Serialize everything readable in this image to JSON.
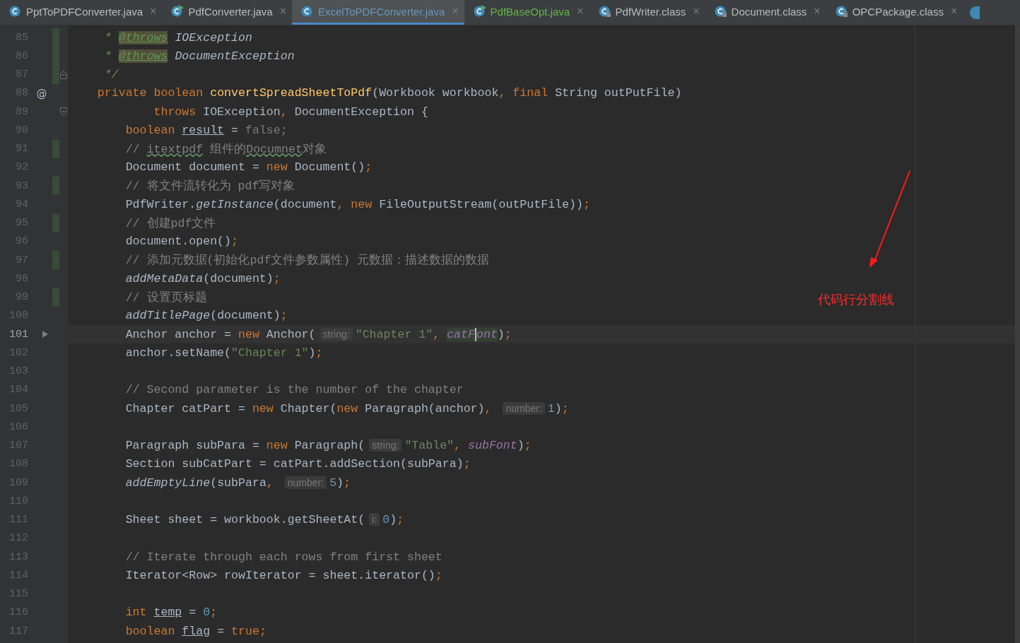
{
  "tabs": [
    {
      "label": "PptToPDFConverter.java",
      "kind": "class",
      "selected": false,
      "color": "#bbbbbb",
      "close": "×"
    },
    {
      "label": "PdfConverter.java",
      "kind": "runnable",
      "selected": false,
      "color": "#bbbbbb",
      "close": "×"
    },
    {
      "label": "ExcelToPDFConverter.java",
      "kind": "class",
      "selected": true,
      "color": "#6897bb",
      "close": "×"
    },
    {
      "label": "PdfBaseOpt.java",
      "kind": "runnable",
      "selected": false,
      "color": "#62b543",
      "close": "×"
    },
    {
      "label": "PdfWriter.class",
      "kind": "locked",
      "selected": false,
      "color": "#bbbbbb",
      "close": "×"
    },
    {
      "label": "Document.class",
      "kind": "locked",
      "selected": false,
      "color": "#bbbbbb",
      "close": "×"
    },
    {
      "label": "OPCPackage.class",
      "kind": "locked",
      "selected": false,
      "color": "#bbbbbb",
      "close": "×"
    }
  ],
  "lines": [
    {
      "number": "85",
      "changed": true,
      "current": false,
      "tokens": [
        {
          "kind": "doc",
          "text": "     * "
        },
        {
          "kind": "doctag",
          "text": "@throws"
        },
        {
          "kind": "docref",
          "text": " IOException"
        }
      ]
    },
    {
      "number": "86",
      "changed": true,
      "current": false,
      "tokens": [
        {
          "kind": "doc",
          "text": "     * "
        },
        {
          "kind": "doctag",
          "text": "@throws"
        },
        {
          "kind": "docref",
          "text": " DocumentException"
        }
      ]
    },
    {
      "number": "87",
      "changed": true,
      "current": false,
      "fold": {
        "kind": "end"
      },
      "tokens": [
        {
          "kind": "doc",
          "text": "     */"
        }
      ]
    },
    {
      "number": "88",
      "changed": false,
      "current": false,
      "gutter_mark": "@",
      "tokens": [
        {
          "kind": "keyword",
          "text": "    private boolean "
        },
        {
          "kind": "method",
          "text": "convertSpreadSheetToPdf"
        },
        {
          "kind": "plain",
          "text": "(Workbook workbook"
        },
        {
          "kind": "keyword",
          "text": ", final "
        },
        {
          "kind": "plain",
          "text": "String outPutFile)"
        }
      ]
    },
    {
      "number": "89",
      "changed": false,
      "current": false,
      "fold": {
        "kind": "start"
      },
      "tokens": [
        {
          "kind": "keyword",
          "text": "            throws"
        },
        {
          "kind": "plain",
          "text": " IOException"
        },
        {
          "kind": "keyword",
          "text": ","
        },
        {
          "kind": "plain",
          "text": " DocumentException {"
        }
      ]
    },
    {
      "number": "90",
      "changed": false,
      "current": false,
      "tokens": [
        {
          "kind": "keyword",
          "text": "        boolean "
        },
        {
          "kind": "underline",
          "text": "result"
        },
        {
          "kind": "plain",
          "text": " = "
        },
        {
          "kind": "dim",
          "text": "false;"
        }
      ]
    },
    {
      "number": "91",
      "changed": true,
      "current": false,
      "tokens": [
        {
          "kind": "comment",
          "text": "        // "
        },
        {
          "kind": "typo",
          "text": "itextpdf"
        },
        {
          "kind": "comment",
          "text": " 组件的"
        },
        {
          "kind": "typo",
          "text": "Documnet"
        },
        {
          "kind": "comment",
          "text": "对象"
        }
      ]
    },
    {
      "number": "92",
      "changed": false,
      "current": false,
      "tokens": [
        {
          "kind": "plain",
          "text": "        Document document = "
        },
        {
          "kind": "keyword",
          "text": "new"
        },
        {
          "kind": "plain",
          "text": " Document()"
        },
        {
          "kind": "keyword",
          "text": ";"
        }
      ]
    },
    {
      "number": "93",
      "changed": true,
      "current": false,
      "tokens": [
        {
          "kind": "comment",
          "text": "        // 将文件流转化为 pdf写对象"
        }
      ]
    },
    {
      "number": "94",
      "changed": false,
      "current": false,
      "tokens": [
        {
          "kind": "plain",
          "text": "        PdfWriter."
        },
        {
          "kind": "static",
          "text": "getInstance"
        },
        {
          "kind": "plain",
          "text": "(document"
        },
        {
          "kind": "keyword",
          "text": ", new"
        },
        {
          "kind": "plain",
          "text": " FileOutputStream(outPutFile))"
        },
        {
          "kind": "keyword",
          "text": ";"
        }
      ]
    },
    {
      "number": "95",
      "changed": true,
      "current": false,
      "tokens": [
        {
          "kind": "comment",
          "text": "        // 创建pdf文件"
        }
      ]
    },
    {
      "number": "96",
      "changed": false,
      "current": false,
      "tokens": [
        {
          "kind": "plain",
          "text": "        document.open()"
        },
        {
          "kind": "keyword",
          "text": ";"
        }
      ]
    },
    {
      "number": "97",
      "changed": true,
      "current": false,
      "tokens": [
        {
          "kind": "comment",
          "text": "        // 添加元数据(初始化pdf文件参数属性) 元数据：描述数据的数据"
        }
      ]
    },
    {
      "number": "98",
      "changed": false,
      "current": false,
      "tokens": [
        {
          "kind": "static",
          "text": "        addMetaData"
        },
        {
          "kind": "plain",
          "text": "(document)"
        },
        {
          "kind": "keyword",
          "text": ";"
        }
      ]
    },
    {
      "number": "99",
      "changed": true,
      "current": false,
      "tokens": [
        {
          "kind": "comment",
          "text": "        // 设置页标题"
        }
      ]
    },
    {
      "number": "100",
      "changed": false,
      "current": false,
      "tokens": [
        {
          "kind": "static",
          "text": "        addTitlePage"
        },
        {
          "kind": "plain",
          "text": "(document)"
        },
        {
          "kind": "keyword",
          "text": ";"
        }
      ]
    },
    {
      "number": "101",
      "changed": false,
      "current": true,
      "gutter_icon": {
        "kind": "arrow"
      },
      "tokens": [
        {
          "kind": "plain",
          "text": "        Anchor anchor = "
        },
        {
          "kind": "keyword",
          "text": "new"
        },
        {
          "kind": "plain",
          "text": " Anchor("
        },
        {
          "kind": "hint",
          "text": "string:"
        },
        {
          "kind": "string",
          "text": "\"Chapter 1\""
        },
        {
          "kind": "keyword",
          "text": ", "
        },
        {
          "kind": "field-hl",
          "text": "catF"
        },
        {
          "kind": "field-hl-caret",
          "text": "ont"
        },
        {
          "kind": "plain",
          "text": ")"
        },
        {
          "kind": "keyword",
          "text": ";"
        }
      ]
    },
    {
      "number": "102",
      "changed": false,
      "current": false,
      "tokens": [
        {
          "kind": "plain",
          "text": "        anchor.setName("
        },
        {
          "kind": "string",
          "text": "\"Chapter 1\""
        },
        {
          "kind": "plain",
          "text": ")"
        },
        {
          "kind": "keyword",
          "text": ";"
        }
      ]
    },
    {
      "number": "103",
      "changed": false,
      "current": false
    },
    {
      "number": "104",
      "changed": false,
      "current": false,
      "tokens": [
        {
          "kind": "comment",
          "text": "        // Second parameter is the number of the chapter"
        }
      ]
    },
    {
      "number": "105",
      "changed": false,
      "current": false,
      "tokens": [
        {
          "kind": "plain",
          "text": "        Chapter catPart = "
        },
        {
          "kind": "keyword",
          "text": "new"
        },
        {
          "kind": "plain",
          "text": " Chapter("
        },
        {
          "kind": "keyword",
          "text": "new"
        },
        {
          "kind": "plain",
          "text": " Paragraph(anchor)"
        },
        {
          "kind": "keyword",
          "text": ", "
        },
        {
          "kind": "hint",
          "text": "number:"
        },
        {
          "kind": "number",
          "text": "1"
        },
        {
          "kind": "plain",
          "text": ")"
        },
        {
          "kind": "keyword",
          "text": ";"
        }
      ]
    },
    {
      "number": "106",
      "changed": false,
      "current": false
    },
    {
      "number": "107",
      "changed": false,
      "current": false,
      "tokens": [
        {
          "kind": "plain",
          "text": "        Paragraph subPara = "
        },
        {
          "kind": "keyword",
          "text": "new"
        },
        {
          "kind": "plain",
          "text": " Paragraph("
        },
        {
          "kind": "hint",
          "text": "string:"
        },
        {
          "kind": "string",
          "text": "\"Table\""
        },
        {
          "kind": "keyword",
          "text": ", "
        },
        {
          "kind": "field",
          "text": "subFont"
        },
        {
          "kind": "plain",
          "text": ")"
        },
        {
          "kind": "keyword",
          "text": ";"
        }
      ]
    },
    {
      "number": "108",
      "changed": false,
      "current": false,
      "tokens": [
        {
          "kind": "plain",
          "text": "        Section subCatPart = catPart.addSection(subPara)"
        },
        {
          "kind": "keyword",
          "text": ";"
        }
      ]
    },
    {
      "number": "109",
      "changed": false,
      "current": false,
      "tokens": [
        {
          "kind": "static",
          "text": "        addEmptyLine"
        },
        {
          "kind": "plain",
          "text": "(subPara"
        },
        {
          "kind": "keyword",
          "text": ", "
        },
        {
          "kind": "hint",
          "text": "number:"
        },
        {
          "kind": "number",
          "text": "5"
        },
        {
          "kind": "plain",
          "text": ")"
        },
        {
          "kind": "keyword",
          "text": ";"
        }
      ]
    },
    {
      "number": "110",
      "changed": false,
      "current": false
    },
    {
      "number": "111",
      "changed": false,
      "current": false,
      "tokens": [
        {
          "kind": "plain",
          "text": "        Sheet sheet = workbook.getSheetAt("
        },
        {
          "kind": "hint",
          "text": "i:"
        },
        {
          "kind": "number",
          "text": "0"
        },
        {
          "kind": "plain",
          "text": ")"
        },
        {
          "kind": "keyword",
          "text": ";"
        }
      ]
    },
    {
      "number": "112",
      "changed": false,
      "current": false
    },
    {
      "number": "113",
      "changed": false,
      "current": false,
      "tokens": [
        {
          "kind": "comment",
          "text": "        // Iterate through each rows from first sheet"
        }
      ]
    },
    {
      "number": "114",
      "changed": false,
      "current": false,
      "tokens": [
        {
          "kind": "plain",
          "text": "        Iterator<Row> rowIterator = sheet.iterator()"
        },
        {
          "kind": "keyword",
          "text": ";"
        }
      ]
    },
    {
      "number": "115",
      "changed": false,
      "current": false
    },
    {
      "number": "116",
      "changed": false,
      "current": false,
      "tokens": [
        {
          "kind": "keyword",
          "text": "        int "
        },
        {
          "kind": "underline",
          "text": "temp"
        },
        {
          "kind": "plain",
          "text": " = "
        },
        {
          "kind": "number",
          "text": "0"
        },
        {
          "kind": "keyword",
          "text": ";"
        }
      ]
    },
    {
      "number": "117",
      "changed": false,
      "current": false,
      "tokens": [
        {
          "kind": "keyword",
          "text": "        boolean "
        },
        {
          "kind": "underline",
          "text": "flag"
        },
        {
          "kind": "plain",
          "text": " = "
        },
        {
          "kind": "keyword",
          "text": "true;"
        }
      ]
    }
  ],
  "annotation": {
    "text": "代码行分割线"
  }
}
